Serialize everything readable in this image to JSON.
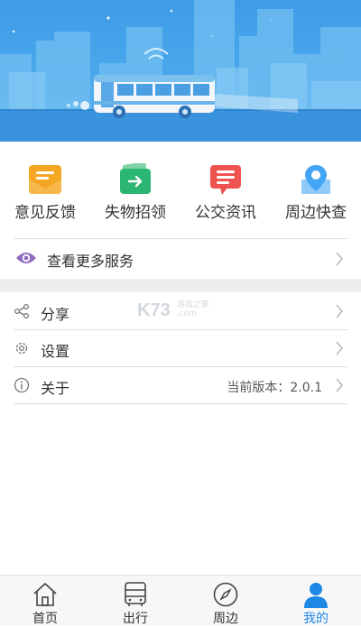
{
  "colors": {
    "accent": "#1e88e5",
    "hero_bg": "#4aa8ec",
    "feedback": "#f5a623",
    "lost": "#2bb673",
    "news": "#ef5350",
    "nearby": "#42a5f5"
  },
  "quick_actions": [
    {
      "label": "意见反馈",
      "icon": "envelope-icon"
    },
    {
      "label": "失物招领",
      "icon": "wallet-icon"
    },
    {
      "label": "公交资讯",
      "icon": "message-icon"
    },
    {
      "label": "周边快查",
      "icon": "map-pin-icon"
    }
  ],
  "more_services": {
    "label": "查看更多服务",
    "icon": "eye-icon"
  },
  "settings_rows": [
    {
      "label": "分享",
      "icon": "share-icon",
      "value": ""
    },
    {
      "label": "设置",
      "icon": "gear-icon",
      "value": ""
    },
    {
      "label": "关于",
      "icon": "info-icon",
      "value": "当前版本：2.0.1"
    }
  ],
  "watermark": {
    "brand": "K73",
    "sub1": "游戏之家",
    "sub2": ".com"
  },
  "tabbar": [
    {
      "label": "首页",
      "icon": "home-icon",
      "active": false
    },
    {
      "label": "出行",
      "icon": "bus-icon",
      "active": false
    },
    {
      "label": "周边",
      "icon": "compass-icon",
      "active": false
    },
    {
      "label": "我的",
      "icon": "user-icon",
      "active": true
    }
  ]
}
